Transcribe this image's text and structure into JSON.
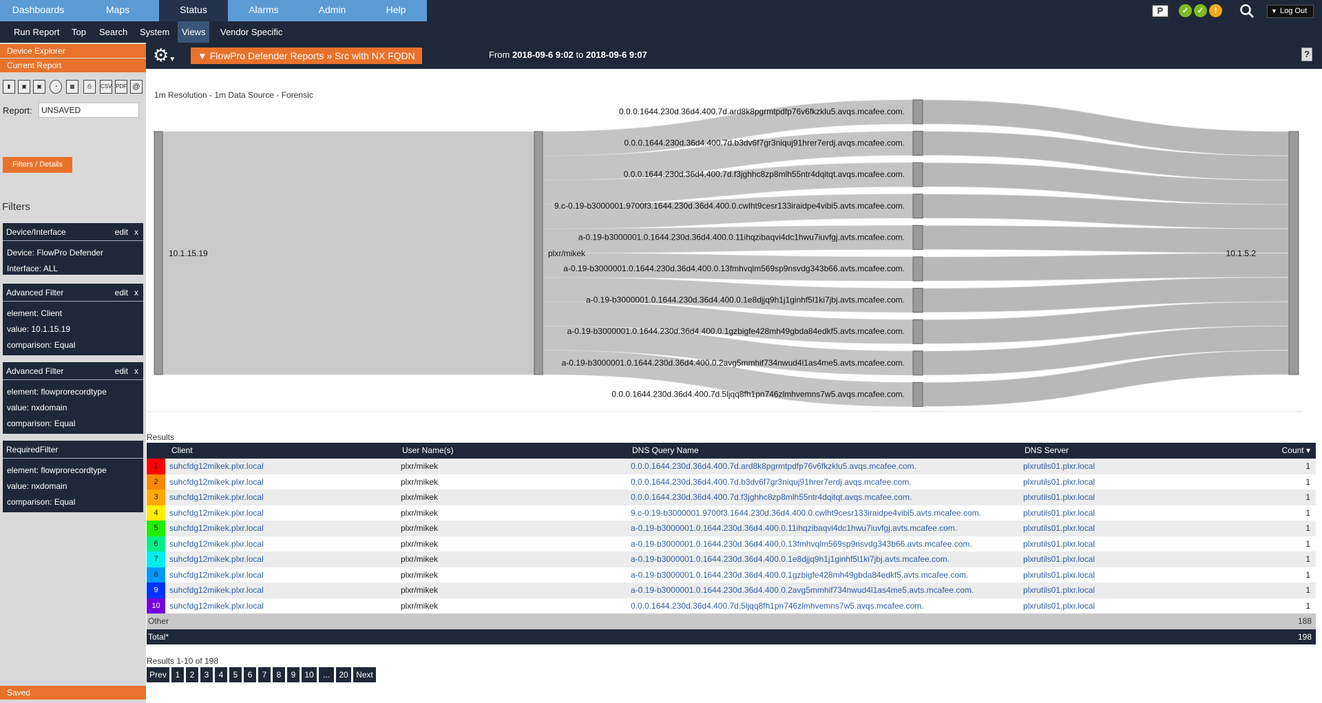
{
  "topnav": {
    "tabs": [
      {
        "label": "Dashboards"
      },
      {
        "label": "Maps"
      },
      {
        "label": "Status"
      },
      {
        "label": "Alarms"
      },
      {
        "label": "Admin"
      },
      {
        "label": "Help"
      }
    ],
    "active_tab": "Status",
    "logout_label": "Log Out",
    "p_badge": "P",
    "status_colors": [
      "#7dbb1f",
      "#7dbb1f",
      "#f2a81d"
    ]
  },
  "subnav": {
    "items": [
      {
        "label": "Run Report"
      },
      {
        "label": "Top"
      },
      {
        "label": "Search"
      },
      {
        "label": "System"
      },
      {
        "label": "Views"
      },
      {
        "label": "Vendor Specific"
      }
    ],
    "active_item": "Views"
  },
  "sidebar": {
    "device_explorer": "Device Explorer",
    "current_report": "Current Report",
    "tool_icons": [
      "new-report-icon",
      "save-icon",
      "save-as-icon",
      "schedule-icon",
      "layout-icon",
      "print-icon",
      "csv-icon",
      "pdf-icon",
      "email-icon"
    ],
    "icon_text": {
      "csv": "CSV",
      "pdf": "PDF",
      "email": "@"
    },
    "report_label": "Report:",
    "report_value": "UNSAVED",
    "filters_details": "Filters / Details",
    "filters_title": "Filters",
    "filter_boxes": [
      {
        "title": "Device/Interface",
        "edit": "edit",
        "close": "x",
        "lines": [
          "Device: FlowPro Defender",
          "Interface: ALL"
        ]
      },
      {
        "title": "Advanced Filter",
        "edit": "edit",
        "close": "x",
        "lines": [
          "element: Client",
          "value: 10.1.15.19",
          "comparison: Equal"
        ]
      },
      {
        "title": "Advanced Filter",
        "edit": "edit",
        "close": "x",
        "lines": [
          "element: flowprorecordtype",
          "value: nxdomain",
          "comparison: Equal"
        ]
      },
      {
        "title": "RequiredFilter",
        "lines": [
          "element: flowprorecordtype",
          "value: nxdomain",
          "comparison: Equal"
        ]
      }
    ],
    "saved": "Saved"
  },
  "report_header": {
    "title": "▼ FlowPro Defender Reports » Src with NX FQDN",
    "from_label": "From",
    "from_value": "2018-09-6 9:02",
    "to_label": "to",
    "to_value": "2018-09-6 9:07",
    "help": "?"
  },
  "resolution_text": "1m Resolution - 1m Data Source - Forensic",
  "sankey": {
    "source": "10.1.15.19",
    "user": "plxr/mikek",
    "server": "10.1.5.2",
    "queries": [
      "0.0.0.1644.230d.36d4.400.7d.ard8k8pgrmtpdfp76v6fkzklu5.avqs.mcafee.com.",
      "0.0.0.1644.230d.36d4.400.7d.b3dv6f7gr3niquj91hrer7erdj.avqs.mcafee.com.",
      "0.0.0.1644.230d.36d4.400.7d.f3jghhc8zp8mlh55ntr4dqitqt.avqs.mcafee.com.",
      "9.c-0.19-b3000001.9700f3.1644.230d.36d4.400.0.cwlht9cesr133iraidpe4vibi5.avts.mcafee.com.",
      "a-0.19-b3000001.0.1644.230d.36d4.400.0.11ihqzibaqvi4dc1hwu7iuvfgj.avts.mcafee.com.",
      "a-0.19-b3000001.0.1644.230d.36d4.400.0.13fmhvqlm569sp9nsvdg343b66.avts.mcafee.com.",
      "a-0.19-b3000001.0.1644.230d.36d4.400.0.1e8djjq9h1j1ginhf5l1ki7jbj.avts.mcafee.com.",
      "a-0.19-b3000001.0.1644.230d.36d4.400.0.1gzbigfe428mh49gbda84edkf5.avts.mcafee.com.",
      "a-0.19-b3000001.0.1644.230d.36d4.400.0.2avg5mmhif734nwud4l1as4me5.avts.mcafee.com.",
      "0.0.0.1644.230d.36d4.400.7d.5ljqq8fh1pn746zlmhvemns7w5.avqs.mcafee.com."
    ]
  },
  "results": {
    "label": "Results",
    "columns": [
      "Client",
      "User Name(s)",
      "DNS Query Name",
      "DNS Server",
      "Count ▾"
    ],
    "rank_colors": [
      "#ff0000",
      "#ff8800",
      "#ffaa00",
      "#ffee00",
      "#22ee00",
      "#00ee88",
      "#00eeee",
      "#0099ff",
      "#0033ff",
      "#7700dd"
    ],
    "rows": [
      {
        "rank": "1",
        "client": "suhcfdg12mikek.plxr.local",
        "user": "plxr/mikek",
        "query": "0.0.0.1644.230d.36d4.400.7d.ard8k8pgrmtpdfp76v6fkzklu5.avqs.mcafee.com.",
        "server": "plxrutils01.plxr.local",
        "count": "1"
      },
      {
        "rank": "2",
        "client": "suhcfdg12mikek.plxr.local",
        "user": "plxr/mikek",
        "query": "0.0.0.1644.230d.36d4.400.7d.b3dv6f7gr3niquj91hrer7erdj.avqs.mcafee.com.",
        "server": "plxrutils01.plxr.local",
        "count": "1"
      },
      {
        "rank": "3",
        "client": "suhcfdg12mikek.plxr.local",
        "user": "plxr/mikek",
        "query": "0.0.0.1644.230d.36d4.400.7d.f3jghhc8zp8mlh55ntr4dqitqt.avqs.mcafee.com.",
        "server": "plxrutils01.plxr.local",
        "count": "1"
      },
      {
        "rank": "4",
        "client": "suhcfdg12mikek.plxr.local",
        "user": "plxr/mikek",
        "query": "9.c-0.19-b3000001.9700f3.1644.230d.36d4.400.0.cwlht9cesr133iraidpe4vibi5.avts.mcafee.com.",
        "server": "plxrutils01.plxr.local",
        "count": "1"
      },
      {
        "rank": "5",
        "client": "suhcfdg12mikek.plxr.local",
        "user": "plxr/mikek",
        "query": "a-0.19-b3000001.0.1644.230d.36d4.400.0.11ihqzibaqvi4dc1hwu7iuvfgj.avts.mcafee.com.",
        "server": "plxrutils01.plxr.local",
        "count": "1"
      },
      {
        "rank": "6",
        "client": "suhcfdg12mikek.plxr.local",
        "user": "plxr/mikek",
        "query": "a-0.19-b3000001.0.1644.230d.36d4.400.0.13fmhvqlm569sp9nsvdg343b66.avts.mcafee.com.",
        "server": "plxrutils01.plxr.local",
        "count": "1"
      },
      {
        "rank": "7",
        "client": "suhcfdg12mikek.plxr.local",
        "user": "plxr/mikek",
        "query": "a-0.19-b3000001.0.1644.230d.36d4.400.0.1e8djjq9h1j1ginhf5l1ki7jbj.avts.mcafee.com.",
        "server": "plxrutils01.plxr.local",
        "count": "1"
      },
      {
        "rank": "8",
        "client": "suhcfdg12mikek.plxr.local",
        "user": "plxr/mikek",
        "query": "a-0.19-b3000001.0.1644.230d.36d4.400.0.1gzbigfe428mh49gbda84edkf5.avts.mcafee.com.",
        "server": "plxrutils01.plxr.local",
        "count": "1"
      },
      {
        "rank": "9",
        "client": "suhcfdg12mikek.plxr.local",
        "user": "plxr/mikek",
        "query": "a-0.19-b3000001.0.1644.230d.36d4.400.0.2avg5mmhif734nwud4l1as4me5.avts.mcafee.com.",
        "server": "plxrutils01.plxr.local",
        "count": "1"
      },
      {
        "rank": "10",
        "client": "suhcfdg12mikek.plxr.local",
        "user": "plxr/mikek",
        "query": "0.0.0.1644.230d.36d4.400.7d.5ljqq8fh1pn746zlmhvemns7w5.avqs.mcafee.com.",
        "server": "plxrutils01.plxr.local",
        "count": "1"
      }
    ],
    "other_label": "Other",
    "other_count": "188",
    "total_label": "Total*",
    "total_count": "198",
    "summary": "Results 1-10 of 198"
  },
  "pager": [
    "Prev",
    "1",
    "2",
    "3",
    "4",
    "5",
    "6",
    "7",
    "8",
    "9",
    "10",
    "...",
    "20",
    "Next"
  ]
}
